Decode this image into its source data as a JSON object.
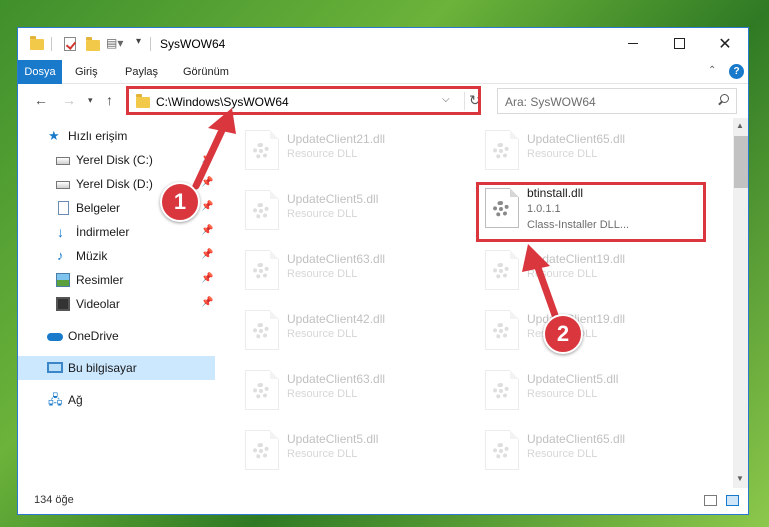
{
  "window": {
    "title": "SysWOW64"
  },
  "ribbon": {
    "tabs": [
      "Dosya",
      "Giriş",
      "Paylaş",
      "Görünüm"
    ]
  },
  "address": {
    "path": "C:\\Windows\\SysWOW64"
  },
  "search": {
    "placeholder": "Ara: SysWOW64"
  },
  "sidebar": {
    "items": [
      {
        "label": "Hızlı erişim",
        "icon": "star-icon"
      },
      {
        "label": "Yerel Disk (C:)",
        "icon": "drive-icon",
        "pinned": true
      },
      {
        "label": "Yerel Disk (D:)",
        "icon": "drive-icon",
        "pinned": true
      },
      {
        "label": "Belgeler",
        "icon": "documents-icon",
        "pinned": true
      },
      {
        "label": "İndirmeler",
        "icon": "download-icon",
        "pinned": true
      },
      {
        "label": "Müzik",
        "icon": "music-icon",
        "pinned": true
      },
      {
        "label": "Resimler",
        "icon": "pictures-icon",
        "pinned": true
      },
      {
        "label": "Videolar",
        "icon": "videos-icon",
        "pinned": true
      },
      {
        "label": "OneDrive",
        "icon": "cloud-icon"
      },
      {
        "label": "Bu bilgisayar",
        "icon": "computer-icon",
        "selected": true
      },
      {
        "label": "Ağ",
        "icon": "network-icon"
      }
    ]
  },
  "files": {
    "left": [
      {
        "name": "UpdateClient21.dll",
        "type": "Resource DLL"
      },
      {
        "name": "UpdateClient5.dll",
        "type": "Resource DLL"
      },
      {
        "name": "UpdateClient63.dll",
        "type": "Resource DLL"
      },
      {
        "name": "UpdateClient42.dll",
        "type": "Resource DLL"
      },
      {
        "name": "UpdateClient63.dll",
        "type": "Resource DLL"
      },
      {
        "name": "UpdateClient5.dll",
        "type": "Resource DLL"
      }
    ],
    "right": [
      {
        "name": "UpdateClient65.dll",
        "type": "Resource DLL"
      },
      {
        "name": "UpdateClient19.dll",
        "type": "Resource DLL"
      },
      {
        "name": "UpdateClient19.dll",
        "type": "Resource DLL"
      },
      {
        "name": "UpdateClient5.dll",
        "type": "Resource DLL"
      },
      {
        "name": "UpdateClient65.dll",
        "type": "Resource DLL"
      }
    ],
    "highlighted": {
      "name": "btinstall.dll",
      "version": "1.0.1.1",
      "description": "Class-Installer DLL..."
    }
  },
  "status": {
    "item_count": "134 öğe"
  },
  "callouts": [
    "1",
    "2"
  ],
  "colors": {
    "accent": "#1979ca",
    "highlight": "#d9363e",
    "selection": "#cce8ff"
  }
}
